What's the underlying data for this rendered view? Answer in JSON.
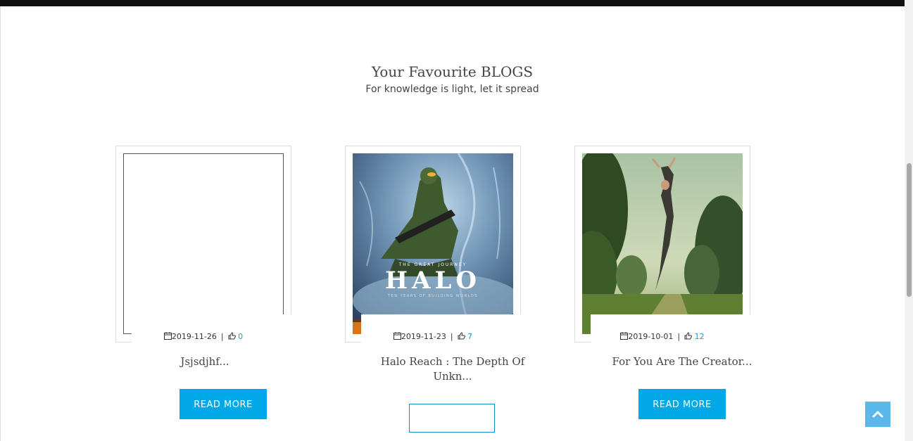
{
  "header": {
    "title": "Your Favourite BLOGS",
    "subtitle": "For knowledge is light, let it spread"
  },
  "colors": {
    "accent": "#00a8e8",
    "likes": "#1a9ad6",
    "top_bar": "#111111",
    "to_top": "#5bb8ea"
  },
  "cards": [
    {
      "date": "2019-11-26",
      "likes": "0",
      "title": "Jsjsdjhf...",
      "button": "READ MORE",
      "image": "blank-frame"
    },
    {
      "date": "2019-11-23",
      "likes": "7",
      "title": "Halo Reach : The Depth Of Unkn...",
      "button": "",
      "image": "halo-poster",
      "image_text": {
        "small": "THE GREAT JOURNEY",
        "logo": "HALO",
        "tagline": "TEN YEARS OF BUILDING WORLDS"
      }
    },
    {
      "date": "2019-10-01",
      "likes": "12",
      "title": "For You Are The Creator...",
      "button": "READ MORE",
      "image": "woman-leaping-in-park"
    }
  ],
  "icons": {
    "date": "calendar-icon",
    "likes": "thumbs-up-icon",
    "to_top": "chevron-up-icon"
  }
}
